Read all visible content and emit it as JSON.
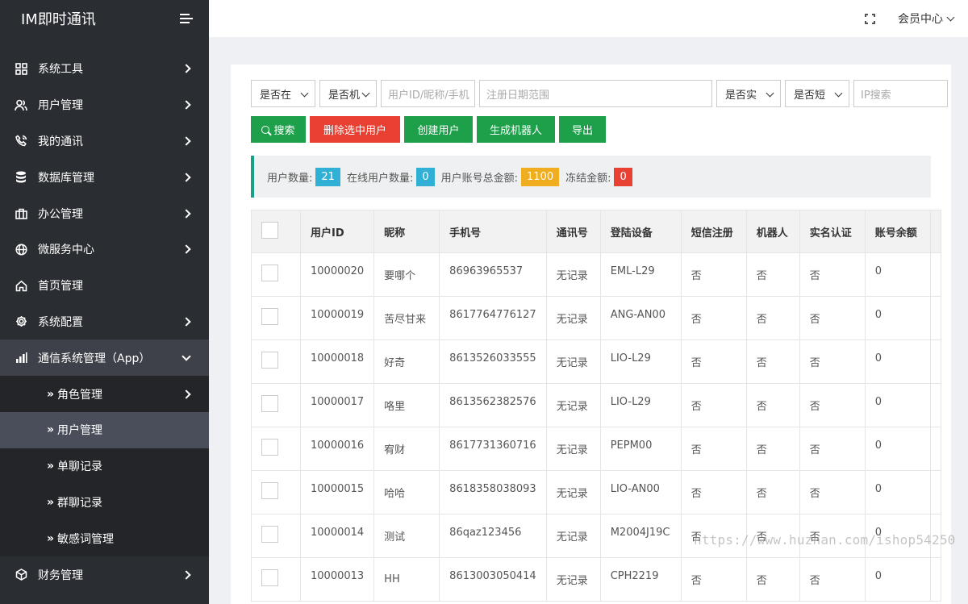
{
  "app": {
    "title": "IM即时通讯"
  },
  "sidebar": {
    "items": [
      {
        "label": "系统工具",
        "icon": "grid-icon",
        "arrow": true
      },
      {
        "label": "用户管理",
        "icon": "users-icon",
        "arrow": true
      },
      {
        "label": "我的通讯",
        "icon": "phone-icon",
        "arrow": true
      },
      {
        "label": "数据库管理",
        "icon": "database-icon",
        "arrow": true
      },
      {
        "label": "办公管理",
        "icon": "briefcase-icon",
        "arrow": true
      },
      {
        "label": "微服务中心",
        "icon": "globe-icon",
        "arrow": true
      },
      {
        "label": "首页管理",
        "icon": "home-icon",
        "arrow": false
      },
      {
        "label": "系统配置",
        "icon": "gear-icon",
        "arrow": true
      },
      {
        "label": "通信系统管理（App）",
        "icon": "bar-chart-icon",
        "arrow": true,
        "open": true
      }
    ],
    "subitems": [
      {
        "label": "角色管理",
        "arrow": true
      },
      {
        "label": "用户管理",
        "active": true
      },
      {
        "label": "单聊记录"
      },
      {
        "label": "群聊记录"
      },
      {
        "label": "敏感词管理"
      }
    ],
    "after": {
      "label": "财务管理",
      "icon": "cube-icon"
    }
  },
  "topbar": {
    "member_label": "会员中心"
  },
  "filters": {
    "sel1": "是否在",
    "sel2": "是否机",
    "user_placeholder": "用户ID/昵称/手机",
    "date_placeholder": "注册日期范围",
    "sel3": "是否实",
    "sel4": "是否短",
    "ip_placeholder": "IP搜索"
  },
  "buttons": {
    "search": "搜索",
    "delete": "删除选中用户",
    "create": "创建用户",
    "robot": "生成机器人",
    "export": "导出"
  },
  "stats": {
    "user_count_label": "用户数量:",
    "user_count": "21",
    "online_label": "在线用户数量:",
    "online": "0",
    "total_amount_label": "用户账号总金额:",
    "total_amount": "1100",
    "frozen_label": "冻结金额:",
    "frozen": "0",
    "colors": {
      "blue": "#31b0d5",
      "yellow": "#f0ad1f",
      "red": "#e84133"
    }
  },
  "table": {
    "headers": [
      "用户ID",
      "昵称",
      "手机号",
      "通讯号",
      "登陆设备",
      "短信注册",
      "机器人",
      "实名认证",
      "账号余额"
    ],
    "rows": [
      [
        "10000020",
        "要哪个",
        "86963965537",
        "无记录",
        "EML-L29",
        "否",
        "否",
        "否",
        "0"
      ],
      [
        "10000019",
        "苦尽甘来",
        "8617764776127",
        "无记录",
        "ANG-AN00",
        "否",
        "否",
        "否",
        "0"
      ],
      [
        "10000018",
        "好奇",
        "8613526033555",
        "无记录",
        "LIO-L29",
        "否",
        "否",
        "否",
        "0"
      ],
      [
        "10000017",
        "咯里",
        "8613562382576",
        "无记录",
        "LIO-L29",
        "否",
        "否",
        "否",
        "0"
      ],
      [
        "10000016",
        "宥财",
        "8617731360716",
        "无记录",
        "PEPM00",
        "否",
        "否",
        "否",
        "0"
      ],
      [
        "10000015",
        "哈哈",
        "8618358038093",
        "无记录",
        "LIO-AN00",
        "否",
        "否",
        "否",
        "0"
      ],
      [
        "10000014",
        "测试",
        "86qaz123456",
        "无记录",
        "M2004J19C",
        "否",
        "否",
        "否",
        "0"
      ],
      [
        "10000013",
        "HH",
        "8613003050414",
        "无记录",
        "CPH2219",
        "否",
        "否",
        "否",
        "0"
      ]
    ]
  },
  "watermark": "https://www.huzhan.com/ishop54250"
}
